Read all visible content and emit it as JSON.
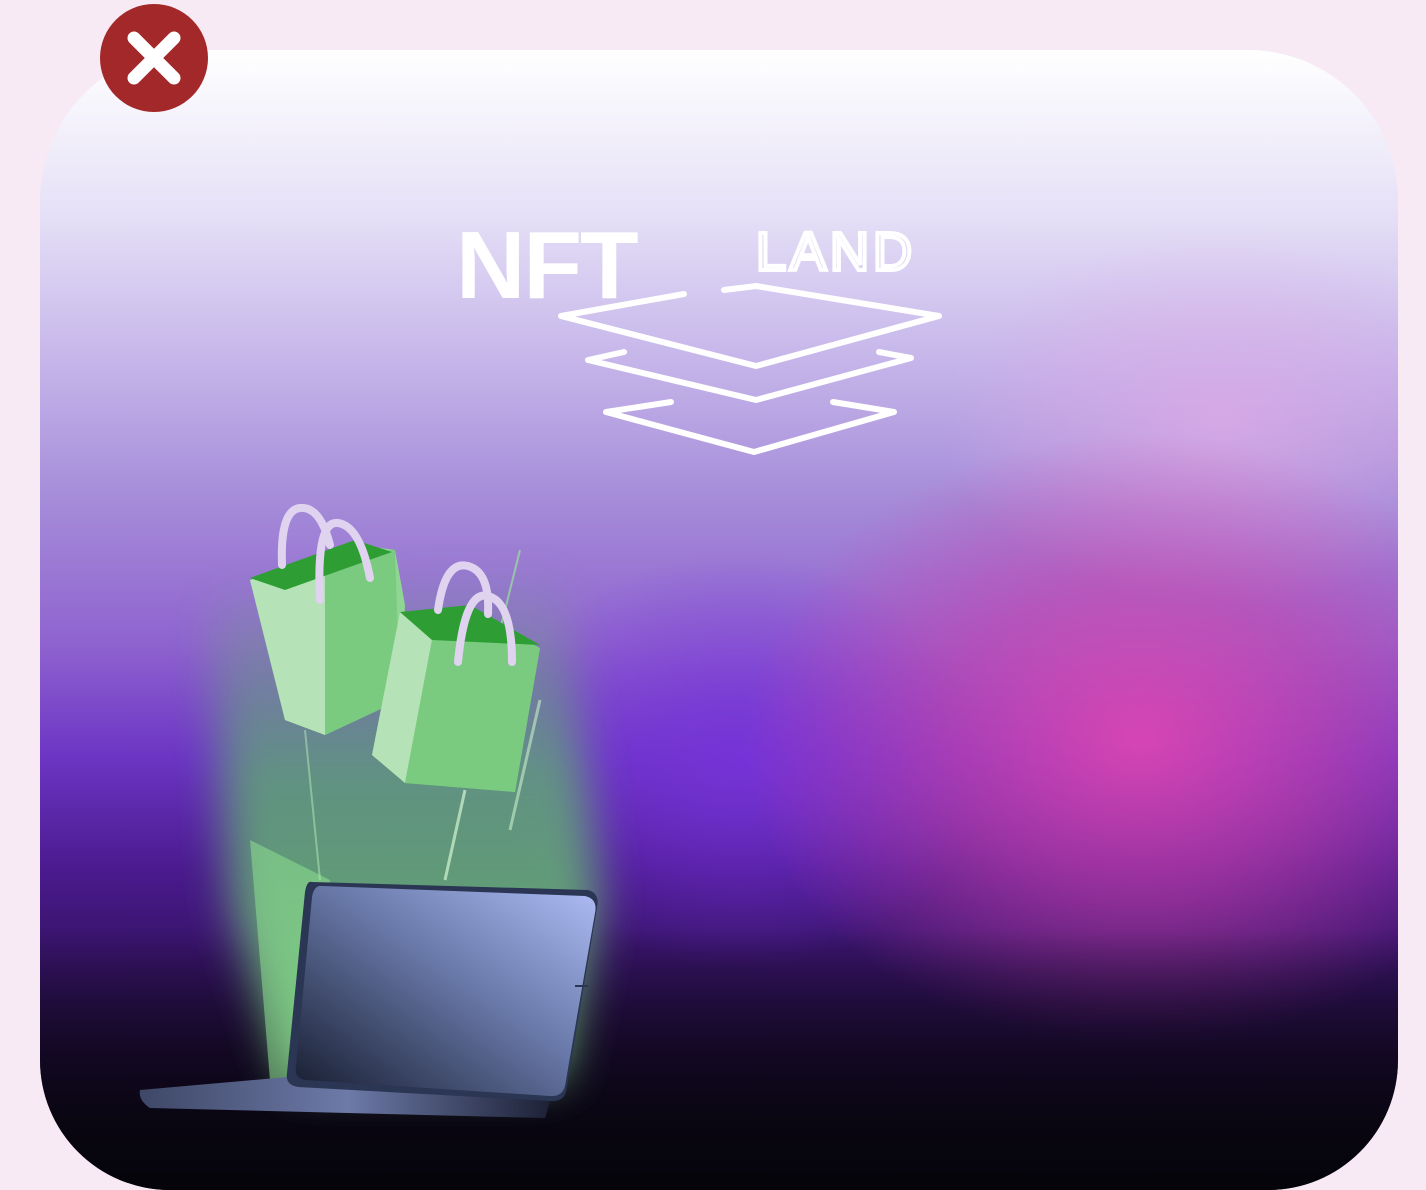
{
  "app": {
    "logo_word_1": "NFT",
    "logo_word_2": "LAND"
  },
  "icons": {
    "close": "close-icon",
    "logo_layers": "layers-icon",
    "shopping_bag": "shopping-bag-icon",
    "laptop": "laptop-icon"
  },
  "colors": {
    "page_background": "#f7eaf4",
    "close_button": "#a3282a",
    "bag_green": "#7acb7f",
    "bag_dark_green": "#2e9e34",
    "logo_white": "#ffffff"
  }
}
